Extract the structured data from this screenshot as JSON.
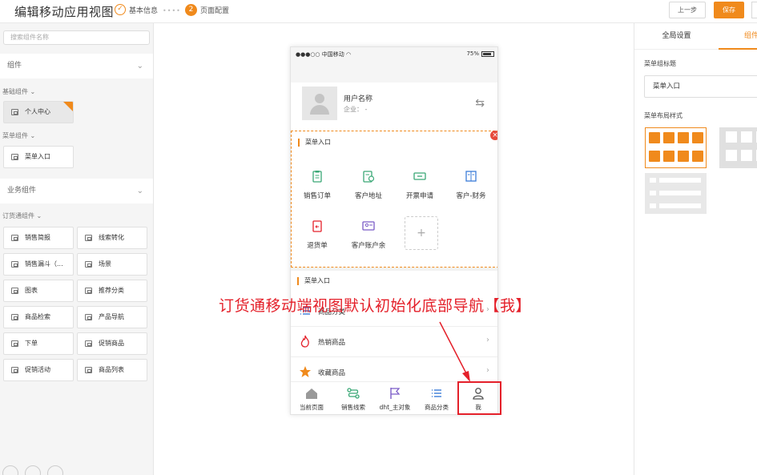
{
  "header": {
    "title": "编辑移动应用视图",
    "step1": {
      "label": "基本信息",
      "mark": "✓"
    },
    "dots": "••••",
    "step2": {
      "label": "页面配置",
      "num": "2"
    },
    "prev_label": "上一步",
    "save_label": "保存"
  },
  "sidebar": {
    "search_placeholder": "搜索组件名称",
    "section1": "组件",
    "group_basic": "基础组件",
    "item_personal": "个人中心",
    "group_menu": "菜单组件",
    "item_menu_entry": "菜单入口",
    "section2": "业务组件",
    "group_order": "订货通组件",
    "items": [
      "销售简报",
      "线索转化",
      "销售漏斗（...",
      "场景",
      "图表",
      "推荐分类",
      "商品检索",
      "产品导航",
      "下单",
      "促销商品",
      "促销活动",
      "商品列表"
    ],
    "chevron": "⌄"
  },
  "phone": {
    "carrier": "●●●○○ 中国移动 ",
    "battery": "75%",
    "user_name": "用户名称",
    "company": "企业： -",
    "swap_icon": "⇆",
    "menu_title": "菜单入口",
    "close": "×",
    "menu_items": [
      "销售订单",
      "客户地址",
      "开票申请",
      "客户-财务",
      "退货单",
      "客户账户余"
    ],
    "add": "+",
    "menu_title2": "菜单入口",
    "rows": [
      "商品分类",
      "热销商品",
      "收藏商品"
    ],
    "arrow": "›",
    "tabs": [
      "当前页面",
      "销售线索",
      "dht_主对象",
      "商品分类",
      "我"
    ]
  },
  "annotation": "订货通移动端视图默认初始化底部导航【我】",
  "right_panel": {
    "tab_global": "全局设置",
    "tab_component": "组件",
    "label_title": "菜单组标题",
    "input_value": "菜单入口",
    "label_layout": "菜单布局样式"
  },
  "colors": {
    "accent": "#f08a1c",
    "annotation": "#e4202a",
    "icon_green": "#3aa876",
    "icon_blue": "#3b7dd8",
    "icon_red": "#e4202a",
    "icon_purple": "#7b5cc7"
  }
}
